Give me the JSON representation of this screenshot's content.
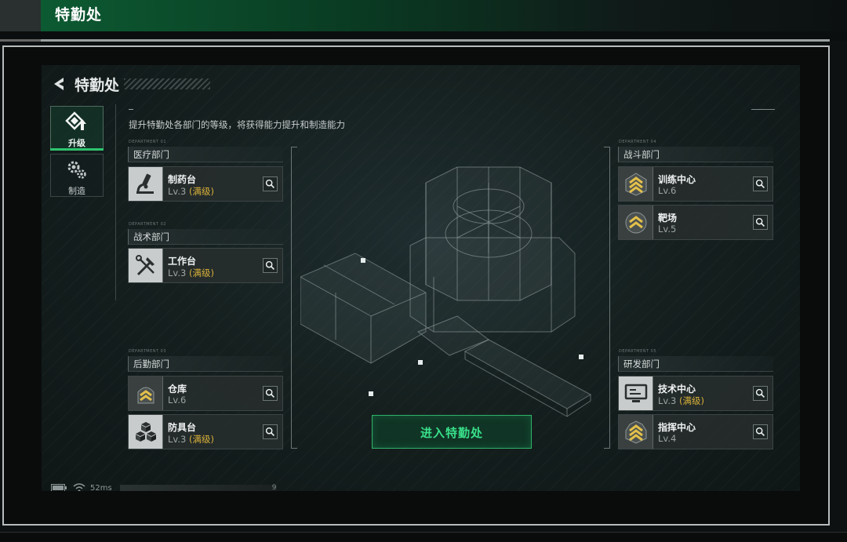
{
  "window": {
    "title": "特勤处"
  },
  "panel": {
    "title": "特勤处",
    "subtitle": "提升特勤处各部门的等级，将获得能力提升和制造能力",
    "enter_button": "进入特勤处",
    "status_ping": "52ms",
    "status_code": "9"
  },
  "tabs": [
    {
      "label": "升级",
      "icon": "upgrade-icon",
      "active": true
    },
    {
      "label": "制造",
      "icon": "gear-icon",
      "active": false
    }
  ],
  "departments": {
    "medical": {
      "label": "医疗部门",
      "items": [
        {
          "name": "制药台",
          "level": "Lv.3",
          "max": "(满级)",
          "icon": "microscope-icon"
        }
      ]
    },
    "tactical": {
      "label": "战术部门",
      "items": [
        {
          "name": "工作台",
          "level": "Lv.3",
          "max": "(满级)",
          "icon": "tools-icon"
        }
      ]
    },
    "logistics": {
      "label": "后勤部门",
      "items": [
        {
          "name": "仓库",
          "level": "Lv.6",
          "max": "",
          "icon": "rank-chevron-icon"
        },
        {
          "name": "防具台",
          "level": "Lv.3",
          "max": "(满级)",
          "icon": "cubes-icon"
        }
      ]
    },
    "combat": {
      "label": "战斗部门",
      "items": [
        {
          "name": "训练中心",
          "level": "Lv.6",
          "max": "",
          "icon": "rank-chevron-icon"
        },
        {
          "name": "靶场",
          "level": "Lv.5",
          "max": "",
          "icon": "rank-chevron-icon"
        }
      ]
    },
    "research": {
      "label": "研发部门",
      "items": [
        {
          "name": "技术中心",
          "level": "Lv.3",
          "max": "(满级)",
          "icon": "monitor-icon"
        },
        {
          "name": "指挥中心",
          "level": "Lv.4",
          "max": "",
          "icon": "rank-chevron-icon"
        }
      ]
    }
  },
  "colors": {
    "accent_green": "#2ec46e",
    "max_level_gold": "#d9b13a",
    "rank_gold": "#e2c04a"
  }
}
